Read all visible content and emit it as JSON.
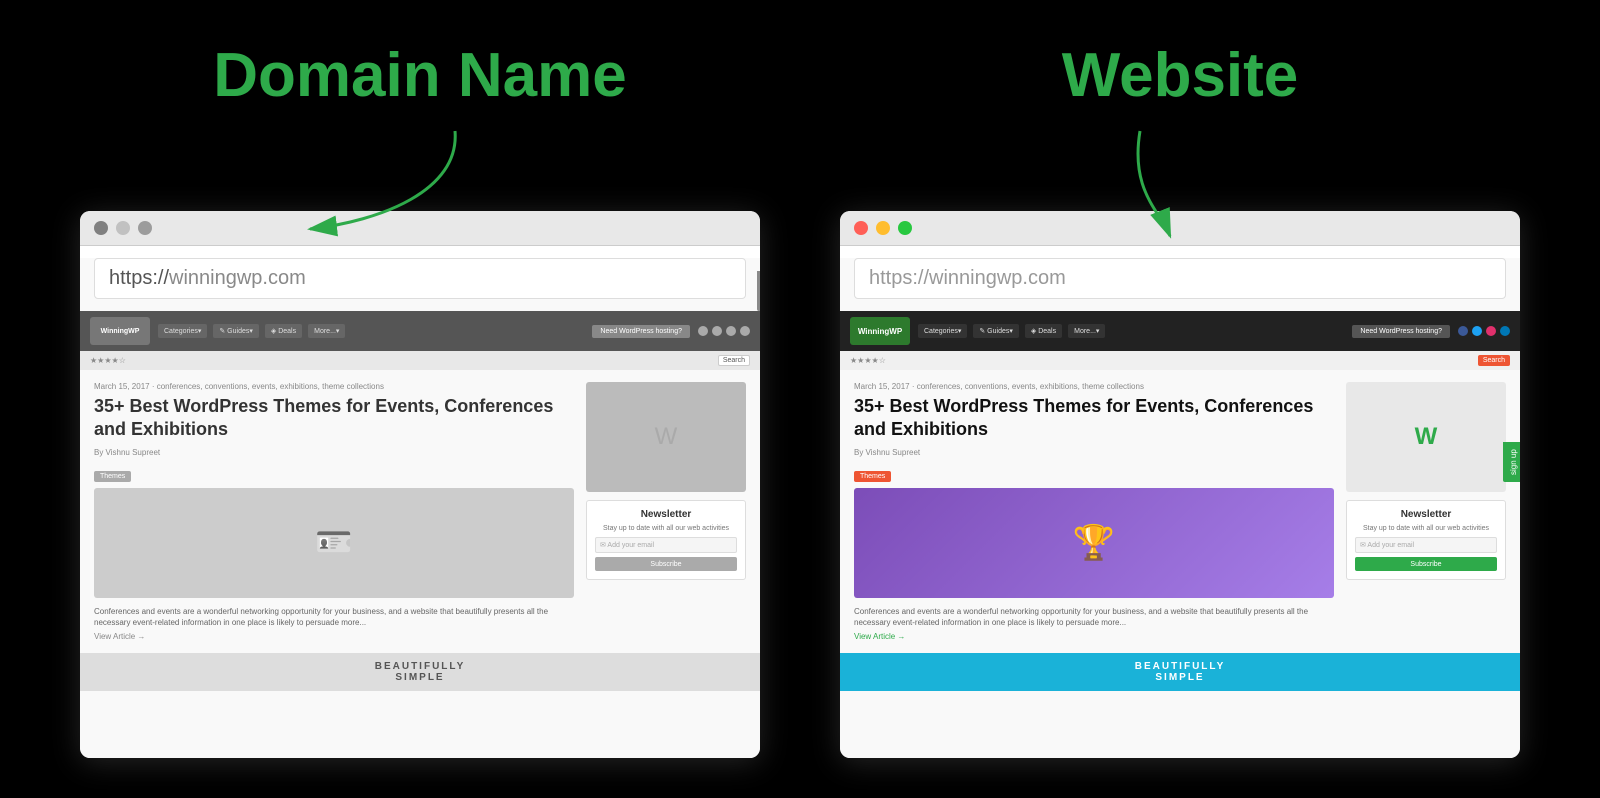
{
  "left_panel": {
    "title": "Domain Name",
    "url": "https://",
    "url_domain": "winningwp.com",
    "article": {
      "date": "March 15, 2017 · conferences, conventions, events, exhibitions, theme collections",
      "heading": "35+ Best WordPress Themes for Events, Conferences and Exhibitions",
      "author": "By Vishnu Supreet",
      "tag": "Themes",
      "desc": "Conferences and events are a wonderful networking opportunity for your business, and a website that beautifully presents all the necessary event-related information in one place is likely to persuade more...",
      "link": "View Article →"
    },
    "newsletter": {
      "title": "Newsletter",
      "desc": "Stay up to date with all our web activities",
      "placeholder": "✉ Add your email",
      "button": "Subscribe"
    },
    "bottom_banner": "BEAUTIFULLY\nSIMPLE"
  },
  "right_panel": {
    "title": "Website",
    "url": "https://winningwp.com",
    "article": {
      "date": "March 15, 2017 · conferences, conventions, events, exhibitions, theme collections",
      "heading": "35+ Best WordPress Themes for Events, Conferences and Exhibitions",
      "author": "By Vishnu Supreet",
      "tag": "Themes",
      "desc": "Conferences and events are a wonderful networking opportunity for your business, and a website that beautifully presents all the necessary event-related information in one place is likely to persuade more...",
      "link": "View Article →"
    },
    "newsletter": {
      "title": "Newsletter",
      "desc": "Stay up to date with all our web activities",
      "placeholder": "✉ Add your email",
      "button": "Subscribe"
    },
    "bottom_banner": "BEAUTIFULLY\nSIMPLE"
  },
  "nav": {
    "logo": "WinningWP",
    "items": [
      "Categories▾",
      "✎ Guides▾",
      "◈ Deals",
      "More...▾"
    ],
    "cta": "Need WordPress hosting?"
  },
  "colors": {
    "green": "#2eaa4a",
    "black": "#000000",
    "white": "#ffffff"
  }
}
